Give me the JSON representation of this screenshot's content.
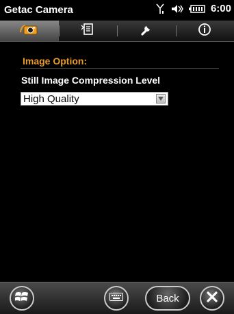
{
  "status_bar": {
    "title": "Getac Camera",
    "time": "6:00",
    "icons": [
      "signal-icon",
      "volume-icon",
      "battery-icon"
    ]
  },
  "tabs": [
    {
      "icon": "camera-icon",
      "active": true
    },
    {
      "icon": "document-icon",
      "active": false
    },
    {
      "icon": "wrench-icon",
      "active": false
    },
    {
      "icon": "info-icon",
      "active": false
    }
  ],
  "image_option": {
    "section_title": "Image Option:",
    "compression_label": "Still Image Compression Level",
    "compression_value": "High Quality"
  },
  "bottom_bar": {
    "back_label": "Back",
    "icons": [
      "windows-start-icon",
      "keyboard-icon",
      "close-icon"
    ]
  },
  "colors": {
    "accent": "#e79a2a",
    "background": "#000000",
    "text": "#ffffff"
  }
}
